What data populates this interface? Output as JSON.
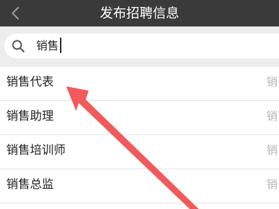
{
  "header": {
    "title": "发布招聘信息",
    "back_icon": "chevron-left-icon"
  },
  "search": {
    "value": "销售",
    "icon": "search-icon"
  },
  "results": [
    {
      "label": "销售代表",
      "tag": "销"
    },
    {
      "label": "销售助理",
      "tag": "销"
    },
    {
      "label": "销售培训师",
      "tag": "销"
    },
    {
      "label": "销售总监",
      "tag": "销"
    }
  ],
  "annotation": {
    "arrow_color": "#f05a5a"
  },
  "colors": {
    "navbar": "#3a3a3a",
    "search_bg": "#ededed",
    "secondary_text": "#b5b5b5"
  }
}
